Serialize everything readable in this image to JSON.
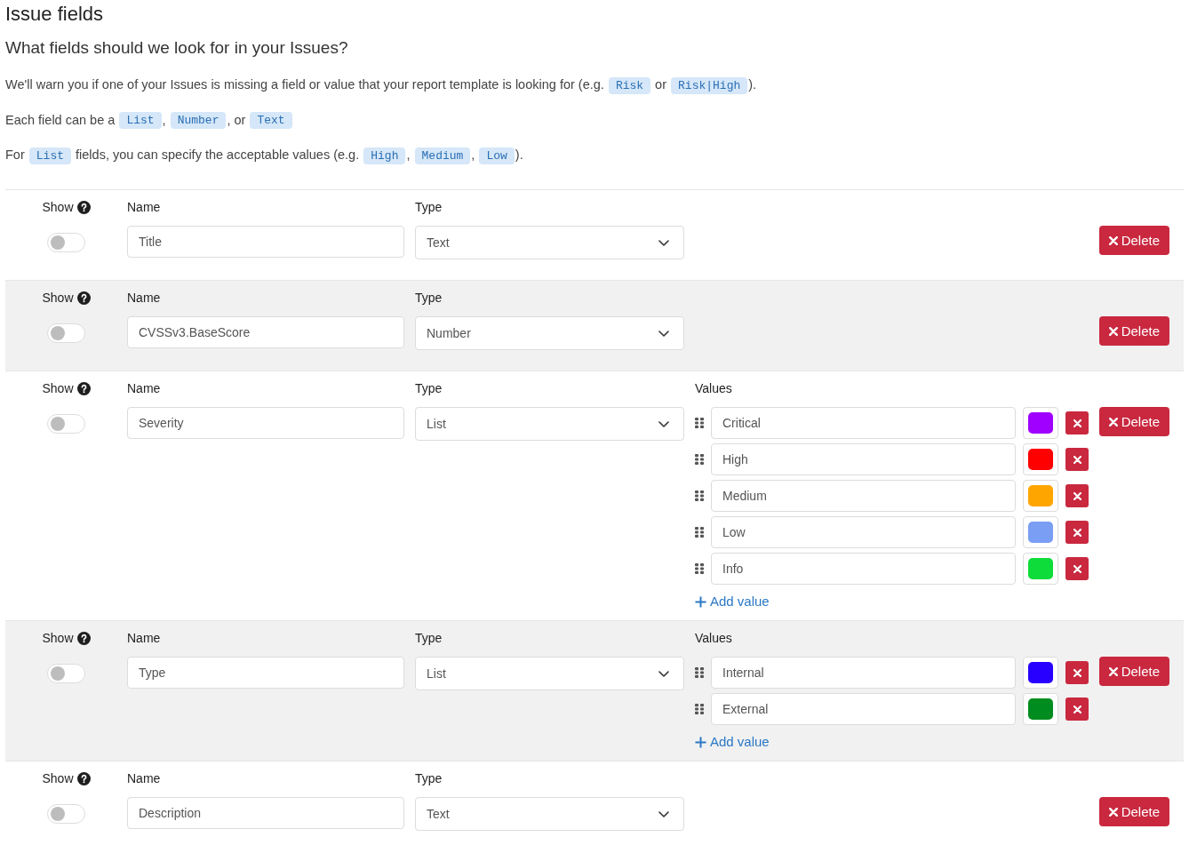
{
  "page": {
    "title": "Issue fields",
    "subtitle": "What fields should we look for in your Issues?"
  },
  "help_paragraphs": [
    [
      {
        "kind": "text",
        "text": "We'll warn you if one of your Issues is missing a field or value that your report template is looking for (e.g. "
      },
      {
        "kind": "code",
        "text": "Risk"
      },
      {
        "kind": "text",
        "text": " or "
      },
      {
        "kind": "code",
        "text": "Risk|High"
      },
      {
        "kind": "text",
        "text": ")."
      }
    ],
    [
      {
        "kind": "text",
        "text": "Each field can be a "
      },
      {
        "kind": "code",
        "text": "List"
      },
      {
        "kind": "text",
        "text": ", "
      },
      {
        "kind": "code",
        "text": "Number"
      },
      {
        "kind": "text",
        "text": ", or "
      },
      {
        "kind": "code",
        "text": "Text"
      }
    ],
    [
      {
        "kind": "text",
        "text": "For "
      },
      {
        "kind": "code",
        "text": "List"
      },
      {
        "kind": "text",
        "text": " fields, you can specify the acceptable values (e.g. "
      },
      {
        "kind": "code",
        "text": "High"
      },
      {
        "kind": "text",
        "text": ", "
      },
      {
        "kind": "code",
        "text": "Medium"
      },
      {
        "kind": "text",
        "text": ", "
      },
      {
        "kind": "code",
        "text": "Low"
      },
      {
        "kind": "text",
        "text": ")."
      }
    ]
  ],
  "fields": [
    {
      "show_label": "Show",
      "show": false,
      "name_label": "Name",
      "name": "Title",
      "type_label": "Type",
      "type": "Text",
      "delete": "Delete"
    },
    {
      "show_label": "Show",
      "show": false,
      "name_label": "Name",
      "name": "CVSSv3.BaseScore",
      "type_label": "Type",
      "type": "Number",
      "delete": "Delete"
    },
    {
      "show_label": "Show",
      "show": false,
      "name_label": "Name",
      "name": "Severity",
      "type_label": "Type",
      "type": "List",
      "values_label": "Values",
      "values": [
        {
          "text": "Critical",
          "color": "#a000ff"
        },
        {
          "text": "High",
          "color": "#ff0000"
        },
        {
          "text": "Medium",
          "color": "#ffa500"
        },
        {
          "text": "Low",
          "color": "#7b9ef5"
        },
        {
          "text": "Info",
          "color": "#0ddc3a"
        }
      ],
      "add_value": "Add value",
      "delete": "Delete"
    },
    {
      "show_label": "Show",
      "show": false,
      "name_label": "Name",
      "name": "Type",
      "type_label": "Type",
      "type": "List",
      "values_label": "Values",
      "values": [
        {
          "text": "Internal",
          "color": "#2800ff"
        },
        {
          "text": "External",
          "color": "#008c1e"
        }
      ],
      "add_value": "Add value",
      "delete": "Delete"
    },
    {
      "show_label": "Show",
      "show": false,
      "name_label": "Name",
      "name": "Description",
      "type_label": "Type",
      "type": "Text",
      "delete": "Delete"
    }
  ]
}
